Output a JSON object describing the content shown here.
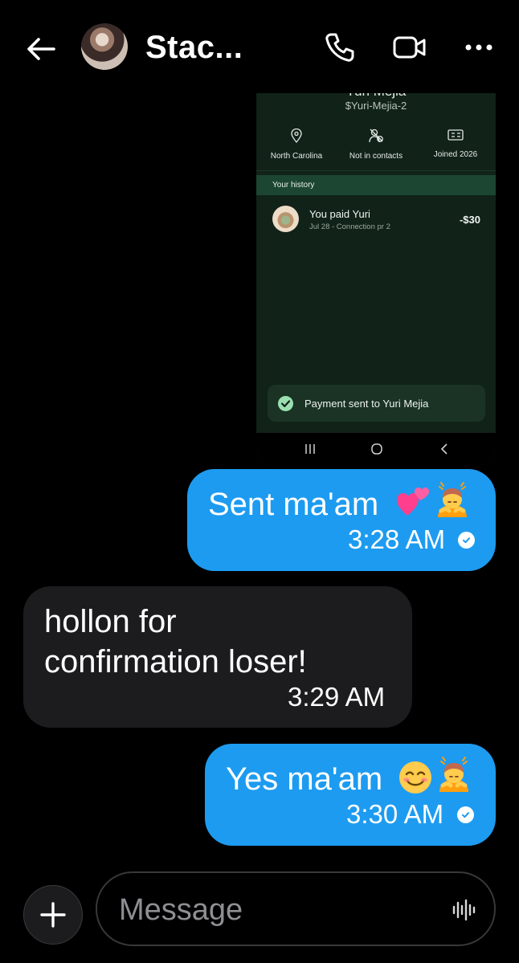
{
  "header": {
    "title": "Stac...",
    "icons": {
      "back": "arrow-left-icon",
      "call": "phone-icon",
      "video": "video-camera-icon",
      "more": "more-dots-icon"
    }
  },
  "attachment": {
    "name_cut": "Yuri Mejia",
    "cashtag": "$Yuri-Mejia-2",
    "info": [
      "North Carolina",
      "Not in contacts",
      "Joined 2026"
    ],
    "history_label": "Your history",
    "transaction": {
      "title": "You paid Yuri",
      "subtitle": "Jul 28 - Connection pr 2",
      "amount": "-$30"
    },
    "toast": "Payment sent to Yuri Mejia",
    "nav": [
      "recents-icon",
      "home-icon",
      "back-icon"
    ]
  },
  "messages": [
    {
      "direction": "sent",
      "text": "Sent ma'am",
      "emoji": [
        "two-hearts-emoji",
        "person-bowing-emoji"
      ],
      "time": "3:28 AM",
      "read": true
    },
    {
      "direction": "received",
      "text_lines": [
        "hollon for",
        "confirmation loser!"
      ],
      "time": "3:29 AM"
    },
    {
      "direction": "sent",
      "text": "Yes ma'am",
      "emoji": [
        "smiling-face-emoji",
        "person-bowing-emoji"
      ],
      "time": "3:30 AM",
      "read": true
    }
  ],
  "composer": {
    "placeholder": "Message",
    "value": ""
  },
  "colors": {
    "sent_bubble": "#1d9bf0",
    "received_bubble": "#1c1c1e",
    "background": "#000000",
    "attachment_bg": "#112219",
    "history_bar": "#1c4631"
  }
}
